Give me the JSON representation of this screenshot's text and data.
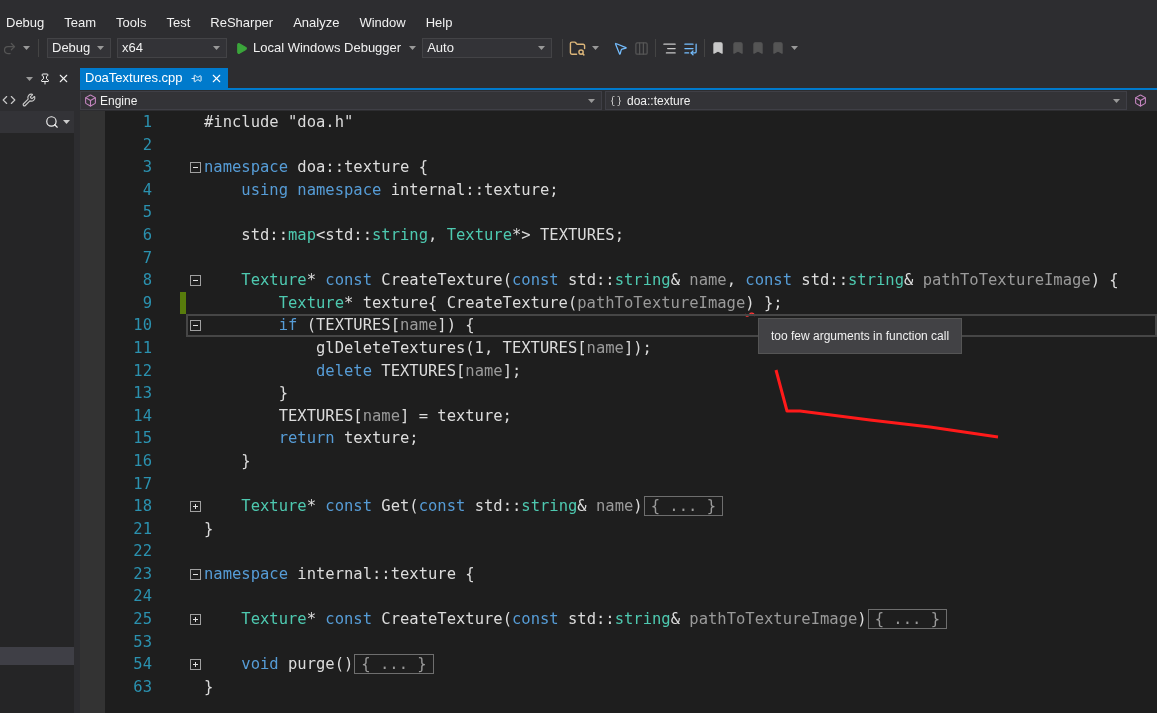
{
  "menu": [
    {
      "label": "Debug"
    },
    {
      "label": "Team"
    },
    {
      "label": "Tools"
    },
    {
      "label": "Test"
    },
    {
      "label": "ReSharper"
    },
    {
      "label": "Analyze"
    },
    {
      "label": "Window"
    },
    {
      "label": "Help"
    }
  ],
  "toolbar": {
    "configuration": "Debug",
    "platform": "x64",
    "debugger": "Local Windows Debugger",
    "target": "Auto"
  },
  "tabs": [
    {
      "label": "DoaTextures.cpp",
      "selected": true
    }
  ],
  "navigation": {
    "project": "Engine",
    "scope": "doa::texture"
  },
  "lines": [
    {
      "number": "1",
      "code": [
        {
          "t": "#include \"doa.h\"",
          "kind": "plain"
        }
      ]
    },
    {
      "number": "2"
    },
    {
      "number": "3",
      "expanded": true,
      "code": [
        {
          "t": "namespace",
          "kind": "keyword"
        },
        {
          "t": " doa::texture {",
          "kind": "plain"
        }
      ]
    },
    {
      "number": "4",
      "code": [
        {
          "t": "    using",
          "kind": "keyword"
        },
        {
          "t": " namespace",
          "kind": "keyword"
        },
        {
          "t": " internal::texture;",
          "kind": "plain"
        }
      ]
    },
    {
      "number": "5"
    },
    {
      "number": "6",
      "code": [
        {
          "t": "    std::",
          "kind": "plain"
        },
        {
          "t": "map",
          "kind": "type"
        },
        {
          "t": "<std::",
          "kind": "plain"
        },
        {
          "t": "string",
          "kind": "type"
        },
        {
          "t": ", ",
          "kind": "plain"
        },
        {
          "t": "Texture",
          "kind": "type"
        },
        {
          "t": "*> TEXTURES;",
          "kind": "plain"
        }
      ]
    },
    {
      "number": "7"
    },
    {
      "number": "8",
      "expanded": true,
      "code": [
        {
          "t": "    Texture",
          "kind": "type"
        },
        {
          "t": "* ",
          "kind": "plain"
        },
        {
          "t": "const",
          "kind": "keyword"
        },
        {
          "t": " CreateTexture(",
          "kind": "plain"
        },
        {
          "t": "const",
          "kind": "keyword"
        },
        {
          "t": " std::",
          "kind": "plain"
        },
        {
          "t": "string",
          "kind": "type"
        },
        {
          "t": "& ",
          "kind": "plain"
        },
        {
          "t": "name",
          "kind": "param"
        },
        {
          "t": ", ",
          "kind": "plain"
        },
        {
          "t": "const",
          "kind": "keyword"
        },
        {
          "t": " std::",
          "kind": "plain"
        },
        {
          "t": "string",
          "kind": "type"
        },
        {
          "t": "& ",
          "kind": "plain"
        },
        {
          "t": "pathToTextureImage",
          "kind": "param"
        },
        {
          "t": ") {",
          "kind": "plain"
        }
      ]
    },
    {
      "number": "9",
      "changed": true,
      "code": [
        {
          "t": "        Texture",
          "kind": "type"
        },
        {
          "t": "* texture{ CreateTexture(",
          "kind": "plain"
        },
        {
          "t": "pathToTextureImage",
          "kind": "param"
        },
        {
          "t": ")",
          "kind": "plain",
          "error": true
        },
        {
          "t": " };",
          "kind": "plain"
        }
      ]
    },
    {
      "number": "10",
      "expanded": true,
      "selected": true,
      "code": [
        {
          "t": "        if",
          "kind": "keyword"
        },
        {
          "t": " (TEXTURES[",
          "kind": "plain"
        },
        {
          "t": "name",
          "kind": "param"
        },
        {
          "t": "]) {",
          "kind": "plain"
        }
      ]
    },
    {
      "number": "11",
      "code": [
        {
          "t": "            glDeleteTextures(1, TEXTURES[",
          "kind": "plain"
        },
        {
          "t": "name",
          "kind": "param"
        },
        {
          "t": "]);",
          "kind": "plain"
        }
      ]
    },
    {
      "number": "12",
      "code": [
        {
          "t": "            delete",
          "kind": "keyword"
        },
        {
          "t": " TEXTURES[",
          "kind": "plain"
        },
        {
          "t": "name",
          "kind": "param"
        },
        {
          "t": "];",
          "kind": "plain"
        }
      ]
    },
    {
      "number": "13",
      "code": [
        {
          "t": "        }",
          "kind": "plain"
        }
      ]
    },
    {
      "number": "14",
      "code": [
        {
          "t": "        TEXTURES[",
          "kind": "plain"
        },
        {
          "t": "name",
          "kind": "param"
        },
        {
          "t": "] = texture;",
          "kind": "plain"
        }
      ]
    },
    {
      "number": "15",
      "code": [
        {
          "t": "        return",
          "kind": "keyword"
        },
        {
          "t": " texture;",
          "kind": "plain"
        }
      ]
    },
    {
      "number": "16",
      "code": [
        {
          "t": "    }",
          "kind": "plain"
        }
      ]
    },
    {
      "number": "17"
    },
    {
      "number": "18",
      "expanded": false,
      "code": [
        {
          "t": "    Texture",
          "kind": "type"
        },
        {
          "t": "* ",
          "kind": "plain"
        },
        {
          "t": "const",
          "kind": "keyword"
        },
        {
          "t": " Get(",
          "kind": "plain"
        },
        {
          "t": "const",
          "kind": "keyword"
        },
        {
          "t": " std::",
          "kind": "plain"
        },
        {
          "t": "string",
          "kind": "type"
        },
        {
          "t": "& ",
          "kind": "plain"
        },
        {
          "t": "name",
          "kind": "param"
        },
        {
          "t": ")",
          "kind": "plain"
        },
        {
          "t": "{ ... }",
          "kind": "collapsed"
        }
      ]
    },
    {
      "number": "21",
      "code": [
        {
          "t": "}",
          "kind": "plain"
        }
      ]
    },
    {
      "number": "22"
    },
    {
      "number": "23",
      "expanded": true,
      "code": [
        {
          "t": "namespace",
          "kind": "keyword"
        },
        {
          "t": " internal::texture {",
          "kind": "plain"
        }
      ]
    },
    {
      "number": "24"
    },
    {
      "number": "25",
      "expanded": false,
      "code": [
        {
          "t": "    Texture",
          "kind": "type"
        },
        {
          "t": "* ",
          "kind": "plain"
        },
        {
          "t": "const",
          "kind": "keyword"
        },
        {
          "t": " CreateTexture(",
          "kind": "plain"
        },
        {
          "t": "const",
          "kind": "keyword"
        },
        {
          "t": " std::",
          "kind": "plain"
        },
        {
          "t": "string",
          "kind": "type"
        },
        {
          "t": "& ",
          "kind": "plain"
        },
        {
          "t": "pathToTextureImage",
          "kind": "param"
        },
        {
          "t": ")",
          "kind": "plain"
        },
        {
          "t": "{ ... }",
          "kind": "collapsed"
        }
      ]
    },
    {
      "number": "53"
    },
    {
      "number": "54",
      "expanded": false,
      "code": [
        {
          "t": "    void",
          "kind": "keyword"
        },
        {
          "t": " purge()",
          "kind": "plain"
        },
        {
          "t": "{ ... }",
          "kind": "collapsed"
        }
      ]
    },
    {
      "number": "63",
      "code": [
        {
          "t": "}",
          "kind": "plain"
        }
      ]
    }
  ],
  "tooltip": {
    "text": "too few arguments in function call"
  }
}
